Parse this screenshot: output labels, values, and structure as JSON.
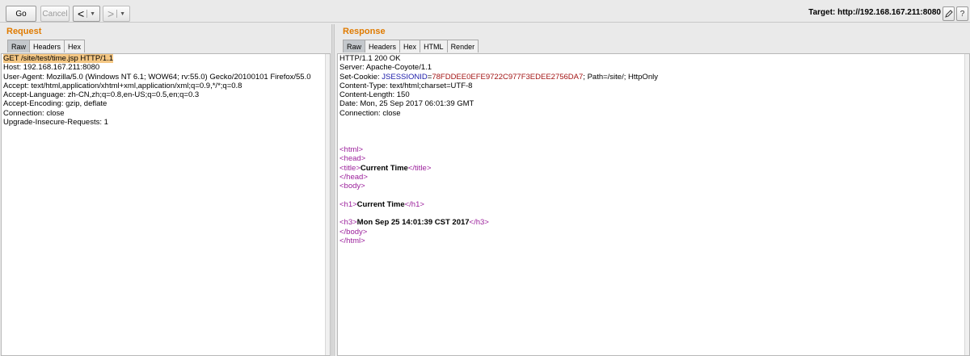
{
  "toolbar": {
    "go_label": "Go",
    "cancel_label": "Cancel",
    "back_icon": "<",
    "forward_icon": ">",
    "target_label": "Target: http://192.168.167.211:8080"
  },
  "request": {
    "title": "Request",
    "tabs": [
      "Raw",
      "Headers",
      "Hex"
    ],
    "active_tab": "Raw",
    "lines": [
      "GET /site/test/time.jsp HTTP/1.1",
      "Host: 192.168.167.211:8080",
      "User-Agent: Mozilla/5.0 (Windows NT 6.1; WOW64; rv:55.0) Gecko/20100101 Firefox/55.0",
      "Accept: text/html,application/xhtml+xml,application/xml;q=0.9,*/*;q=0.8",
      "Accept-Language: zh-CN,zh;q=0.8,en-US;q=0.5,en;q=0.3",
      "Accept-Encoding: gzip, deflate",
      "Connection: close",
      "Upgrade-Insecure-Requests: 1"
    ]
  },
  "response": {
    "title": "Response",
    "tabs": [
      "Raw",
      "Headers",
      "Hex",
      "HTML",
      "Render"
    ],
    "active_tab": "Raw",
    "headers": [
      "HTTP/1.1 200 OK",
      "Server: Apache-Coyote/1.1"
    ],
    "cookie_prefix": "Set-Cookie: ",
    "cookie_name": "JSESSIONID",
    "cookie_eq": "=",
    "cookie_value": "78FDDEE0EFE9722C977F3EDEE2756DA7",
    "cookie_suffix": "; Path=/site/; HttpOnly",
    "headers2": [
      "Content-Type: text/html;charset=UTF-8",
      "Content-Length: 150",
      "Date: Mon, 25 Sep 2017 06:01:39 GMT",
      "Connection: close"
    ],
    "body": {
      "html_open": "<html>",
      "head_open": "<head>",
      "title_open": "<title>",
      "title_text": "Current Time",
      "title_close": "</title>",
      "head_close": "</head>",
      "body_open": "<body>",
      "h1_open": "<h1>",
      "h1_text": "Current Time",
      "h1_close": "</h1>",
      "h3_open": "<h3>",
      "h3_text": "Mon Sep 25 14:01:39 CST 2017",
      "h3_close": "</h3>",
      "body_close": "</body>",
      "html_close": "</html>"
    }
  },
  "colors": {
    "panel_title": "#e07b00",
    "tag": "#9b1f9b",
    "cookie_name": "#1a1aa8",
    "cookie_value": "#a31515",
    "highlight": "#f4c784"
  }
}
